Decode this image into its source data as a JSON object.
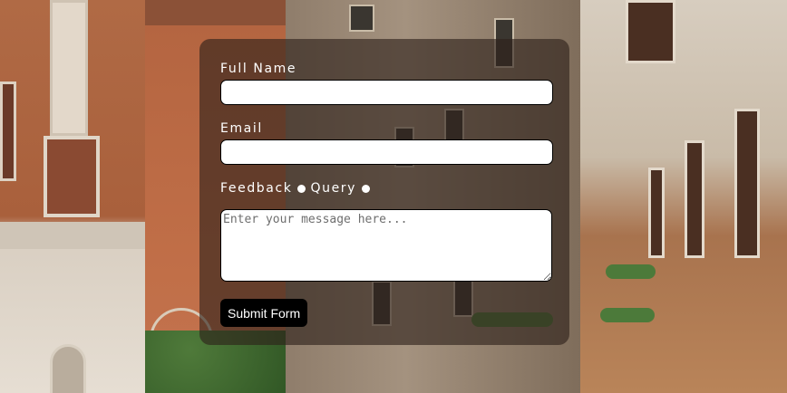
{
  "form": {
    "full_name_label": "Full Name",
    "full_name_value": "",
    "email_label": "Email",
    "email_value": "",
    "radio_options": [
      "Feedback",
      "Query"
    ],
    "message_placeholder": "Enter your message here...",
    "submit_label": "Submit Form"
  },
  "colors": {
    "card_overlay": "#2d201a",
    "label_text": "#ffffff",
    "button_bg": "#000000",
    "button_text": "#ffffff"
  },
  "icons": {
    "radio": "filled-circle"
  }
}
